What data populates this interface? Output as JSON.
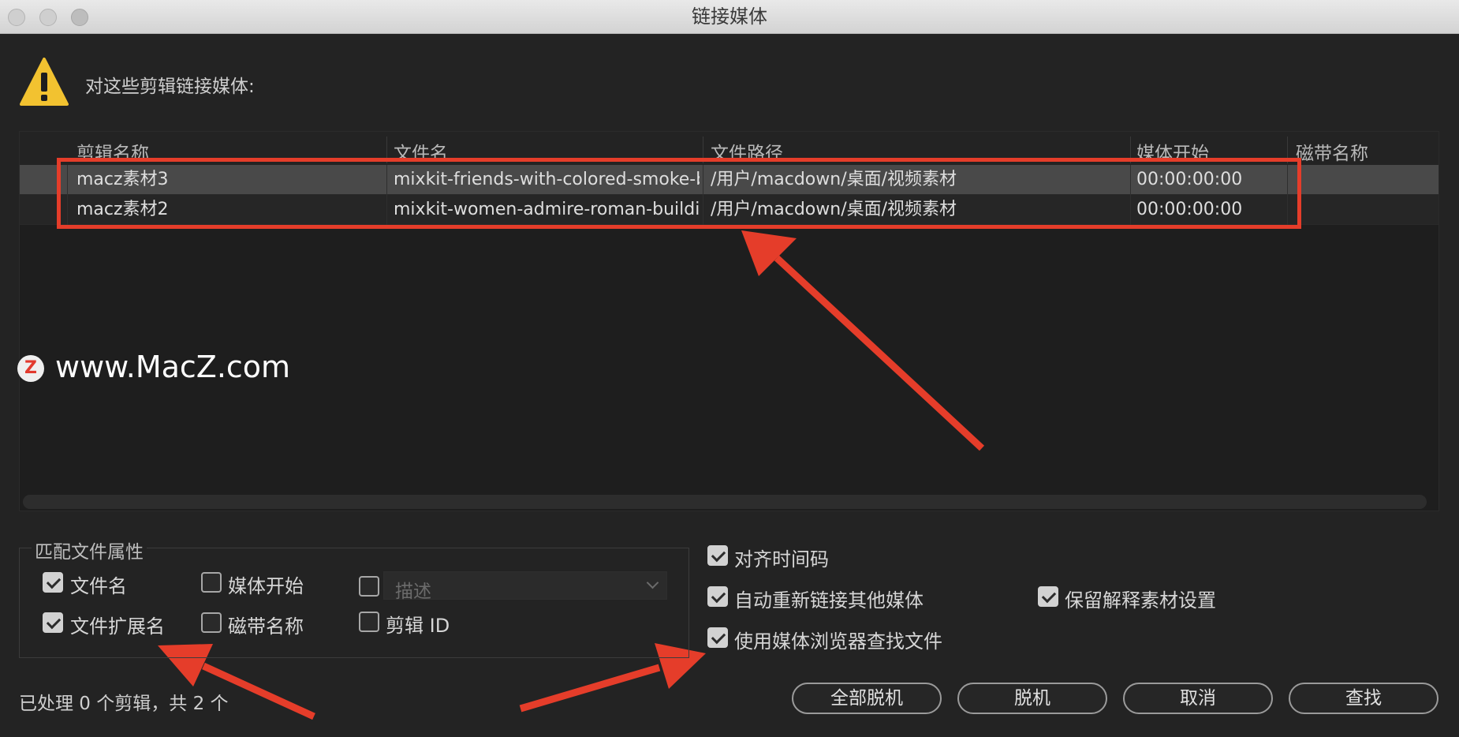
{
  "window": {
    "title": "链接媒体"
  },
  "header": {
    "text": "对这些剪辑链接媒体:",
    "icon": "warning-icon"
  },
  "table": {
    "columns": [
      "剪辑名称",
      "文件名",
      "文件路径",
      "媒体开始",
      "磁带名称"
    ],
    "rows": [
      {
        "clip_name": "macz素材3",
        "file_name": "mixkit-friends-with-colored-smoke-bom",
        "file_path": "/用户/macdown/桌面/视频素材",
        "media_start": "00:00:00:00",
        "tape_name": ""
      },
      {
        "clip_name": "macz素材2",
        "file_name": "mixkit-women-admire-roman-buildings-",
        "file_path": "/用户/macdown/桌面/视频素材",
        "media_start": "00:00:00:00",
        "tape_name": ""
      }
    ]
  },
  "watermark": {
    "logo_letter": "Z",
    "text": "www.MacZ.com"
  },
  "match_properties": {
    "title": "匹配文件属性",
    "file_name": {
      "label": "文件名",
      "checked": true
    },
    "media_start": {
      "label": "媒体开始",
      "checked": false
    },
    "description": {
      "label": "描述",
      "checked": false,
      "select_value": "描述"
    },
    "file_extension": {
      "label": "文件扩展名",
      "checked": true
    },
    "tape_name": {
      "label": "磁带名称",
      "checked": false
    },
    "clip_id": {
      "label": "剪辑 ID",
      "checked": false
    }
  },
  "options": {
    "align_timecode": {
      "label": "对齐时间码",
      "checked": true
    },
    "auto_relink": {
      "label": "自动重新链接其他媒体",
      "checked": true
    },
    "preserve_interpret": {
      "label": "保留解释素材设置",
      "checked": true
    },
    "use_media_browser": {
      "label": "使用媒体浏览器查找文件",
      "checked": true
    }
  },
  "status": {
    "text": "已处理 0 个剪辑，共 2 个"
  },
  "buttons": {
    "offline_all": "全部脱机",
    "offline": "脱机",
    "cancel": "取消",
    "locate": "查找"
  },
  "colors": {
    "annotation_red": "#e53d2a",
    "warning_yellow": "#f2c230"
  }
}
